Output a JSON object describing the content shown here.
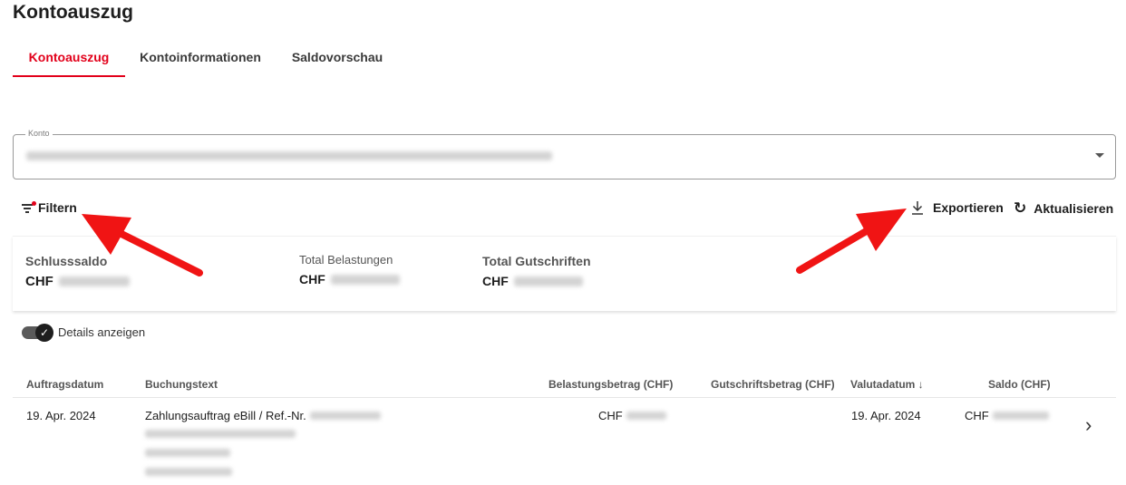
{
  "page": {
    "title": "Kontoauszug"
  },
  "tabs": [
    {
      "label": "Kontoauszug",
      "active": true
    },
    {
      "label": "Kontoinformationen",
      "active": false
    },
    {
      "label": "Saldovorschau",
      "active": false
    }
  ],
  "konto": {
    "label": "Konto"
  },
  "toolbar": {
    "filter_label": "Filtern",
    "export_label": "Exportieren",
    "refresh_label": "Aktualisieren"
  },
  "summary": {
    "schlusssaldo_label": "Schlusssaldo",
    "belastungen_label": "Total Belastungen",
    "gutschriften_label": "Total Gutschriften",
    "currency": "CHF"
  },
  "details_toggle": {
    "label": "Details anzeigen",
    "on": true
  },
  "table": {
    "columns": [
      "Auftragsdatum",
      "Buchungstext",
      "Belastungsbetrag (CHF)",
      "Gutschriftsbetrag (CHF)",
      "Valutadatum ↓",
      "Saldo (CHF)"
    ],
    "rows": [
      {
        "auftragsdatum": "19. Apr. 2024",
        "buchungstext": "Zahlungsauftrag eBill / Ref.-Nr.",
        "belastung_currency": "CHF",
        "valutadatum": "19. Apr. 2024",
        "saldo_currency": "CHF"
      }
    ]
  },
  "colors": {
    "accent": "#e2001a",
    "annotation_arrow": "#f01414"
  }
}
